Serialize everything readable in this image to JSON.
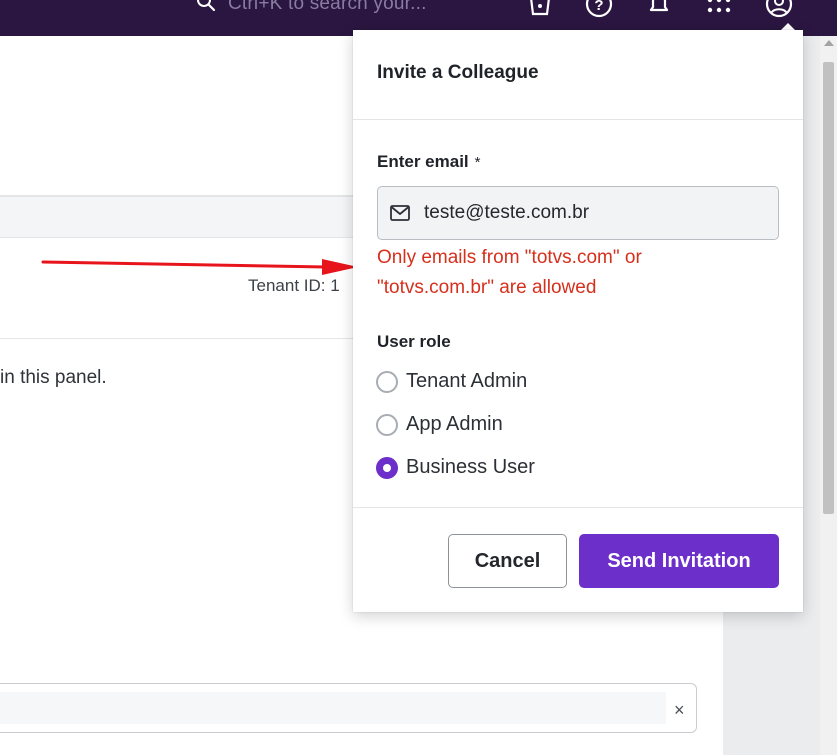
{
  "topbar": {
    "search_placeholder": "Ctrl+K to search your...",
    "icons": [
      "search-icon",
      "apps-store-icon",
      "help-icon",
      "bell-icon",
      "grid-icon",
      "user-icon"
    ]
  },
  "page": {
    "tenant_label": "Tenant ID: 1",
    "panel_text": "in this panel.",
    "clear_symbol": "×"
  },
  "modal": {
    "title": "Invite a Colleague",
    "email_label": "Enter email",
    "required_mark": "*",
    "email_value": "teste@teste.com.br",
    "error_message": "Only emails from \"totvs.com\" or \"totvs.com.br\" are allowed",
    "role_label": "User role",
    "roles": [
      {
        "label": "Tenant Admin",
        "checked": false
      },
      {
        "label": "App Admin",
        "checked": false
      },
      {
        "label": "Business User",
        "checked": true
      }
    ],
    "cancel_label": "Cancel",
    "send_label": "Send Invitation"
  },
  "colors": {
    "topbar": "#2a1640",
    "accent": "#6c2fc9",
    "error": "#d6301d",
    "annotation_arrow": "#e8141b"
  }
}
